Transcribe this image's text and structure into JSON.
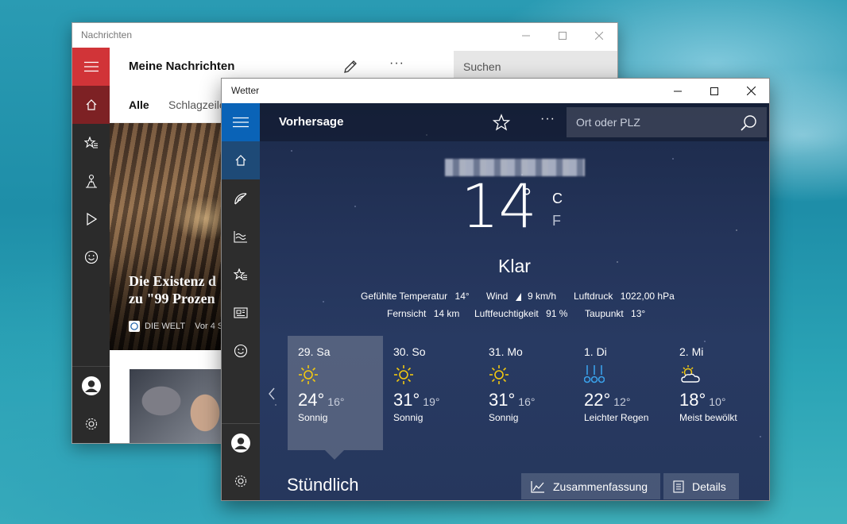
{
  "news": {
    "window_title": "Nachrichten",
    "header_title": "Meine Nachrichten",
    "more_label": "···",
    "search_placeholder": "Suchen",
    "tabs": [
      "Alle",
      "Schlagzeilen"
    ],
    "hero": {
      "headline_line1": "Die Existenz d",
      "headline_line2": "zu \"99 Prozen",
      "source": "DIE WELT",
      "age": "Vor 4 S"
    }
  },
  "weather": {
    "window_title": "Wetter",
    "header_title": "Vorhersage",
    "more_label": "···",
    "search_placeholder": "Ort oder PLZ",
    "current": {
      "temperature": "14",
      "degree_symbol": "°",
      "unit_c": "C",
      "unit_f": "F",
      "condition": "Klar"
    },
    "details": {
      "feels_like_label": "Gefühlte Temperatur",
      "feels_like_value": "14°",
      "wind_label": "Wind",
      "wind_value": "9 km/h",
      "pressure_label": "Luftdruck",
      "pressure_value": "1022,00 hPa",
      "visibility_label": "Fernsicht",
      "visibility_value": "14 km",
      "humidity_label": "Luftfeuchtigkeit",
      "humidity_value": "91 %",
      "dewpoint_label": "Taupunkt",
      "dewpoint_value": "13°"
    },
    "forecast": [
      {
        "day": "29. Sa",
        "icon": "sun-icon",
        "high": "24°",
        "low": "16°",
        "condition": "Sonnig"
      },
      {
        "day": "30. So",
        "icon": "sun-icon",
        "high": "31°",
        "low": "19°",
        "condition": "Sonnig"
      },
      {
        "day": "31. Mo",
        "icon": "sun-icon",
        "high": "31°",
        "low": "16°",
        "condition": "Sonnig"
      },
      {
        "day": "1. Di",
        "icon": "rain-icon",
        "high": "22°",
        "low": "12°",
        "condition": "Leichter Regen"
      },
      {
        "day": "2. Mi",
        "icon": "partly-cloudy-icon",
        "high": "18°",
        "low": "10°",
        "condition": "Meist bewölkt"
      }
    ],
    "hourly_title": "Stündlich",
    "summary_button": "Zusammenfassung",
    "details_button": "Details"
  },
  "colors": {
    "news_accent": "#d13438",
    "weather_accent": "#0a63b7",
    "sun": "#f2c811",
    "rain": "#3aa0e8"
  }
}
